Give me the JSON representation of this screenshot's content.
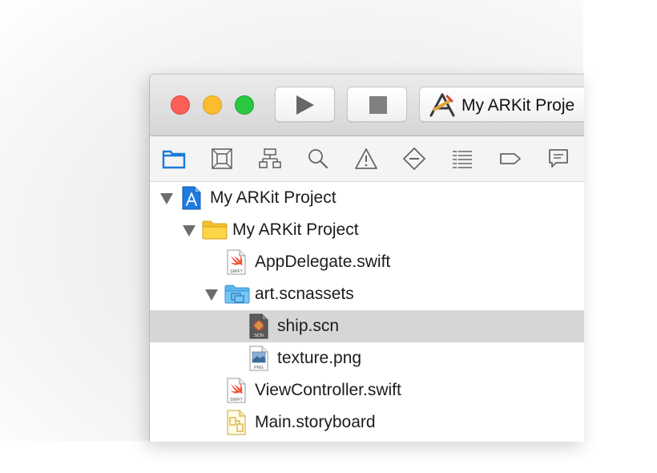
{
  "toolbar": {
    "run_icon": "play-icon",
    "stop_icon": "stop-icon",
    "scheme_icon": "xcode-app-icon",
    "scheme_label": "My ARKit Proje"
  },
  "navigator_tabs": [
    {
      "icon": "folder-icon",
      "selected": true
    },
    {
      "icon": "source-control-icon"
    },
    {
      "icon": "symbol-hierarchy-icon"
    },
    {
      "icon": "search-icon"
    },
    {
      "icon": "warning-icon"
    },
    {
      "icon": "test-diamond-icon"
    },
    {
      "icon": "debug-list-icon"
    },
    {
      "icon": "breakpoint-icon"
    },
    {
      "icon": "report-icon"
    }
  ],
  "file_tree": [
    {
      "label": "My ARKit Project",
      "icon": "project-icon",
      "expanded": true
    },
    {
      "label": "My ARKit Project",
      "icon": "folder-icon",
      "expanded": true
    },
    {
      "label": "AppDelegate.swift",
      "icon": "swift-file-icon",
      "badge": "SWIFT"
    },
    {
      "label": "art.scnassets",
      "icon": "asset-folder-icon",
      "expanded": true
    },
    {
      "label": "ship.scn",
      "icon": "scn-file-icon",
      "badge": "SCN",
      "selected": true
    },
    {
      "label": "texture.png",
      "icon": "png-file-icon",
      "badge": "PNG"
    },
    {
      "label": "ViewController.swift",
      "icon": "swift-file-icon",
      "badge": "SWIFT"
    },
    {
      "label": "Main.storyboard",
      "icon": "storyboard-file-icon"
    }
  ],
  "colors": {
    "close": "#fc5f57",
    "minimize": "#fdbc2e",
    "zoom": "#29c840",
    "accent": "#1b7ad8",
    "folder": "#fdd547",
    "asset_folder": "#77c6f6",
    "selection": "#d6d6d6"
  }
}
